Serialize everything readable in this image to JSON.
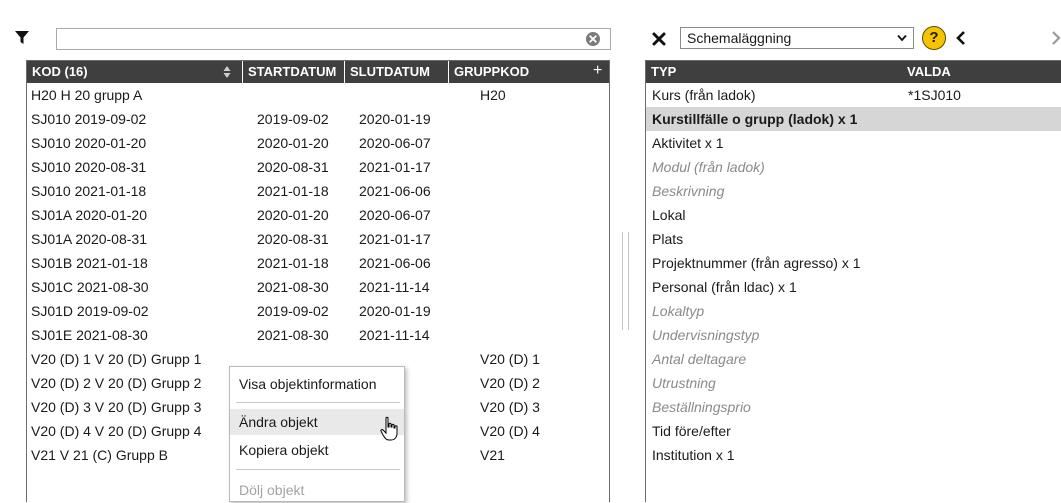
{
  "left_panel": {
    "filter_value": "",
    "columns": [
      "KOD (16)",
      "STARTDATUM",
      "SLUTDATUM",
      "GRUPPKOD"
    ],
    "rows": [
      {
        "kod": "H20 H 20 grupp A",
        "start": "",
        "slut": "",
        "grupp": "H20"
      },
      {
        "kod": "SJ010 2019-09-02",
        "start": "2019-09-02",
        "slut": "2020-01-19",
        "grupp": ""
      },
      {
        "kod": "SJ010 2020-01-20",
        "start": "2020-01-20",
        "slut": "2020-06-07",
        "grupp": ""
      },
      {
        "kod": "SJ010 2020-08-31",
        "start": "2020-08-31",
        "slut": "2021-01-17",
        "grupp": ""
      },
      {
        "kod": "SJ010 2021-01-18",
        "start": "2021-01-18",
        "slut": "2021-06-06",
        "grupp": ""
      },
      {
        "kod": "SJ01A 2020-01-20",
        "start": "2020-01-20",
        "slut": "2020-06-07",
        "grupp": ""
      },
      {
        "kod": "SJ01A 2020-08-31",
        "start": "2020-08-31",
        "slut": "2021-01-17",
        "grupp": ""
      },
      {
        "kod": "SJ01B 2021-01-18",
        "start": "2021-01-18",
        "slut": "2021-06-06",
        "grupp": ""
      },
      {
        "kod": "SJ01C 2021-08-30",
        "start": "2021-08-30",
        "slut": "2021-11-14",
        "grupp": ""
      },
      {
        "kod": "SJ01D 2019-09-02",
        "start": "2019-09-02",
        "slut": "2020-01-19",
        "grupp": ""
      },
      {
        "kod": "SJ01E 2021-08-30",
        "start": "2021-08-30",
        "slut": "2021-11-14",
        "grupp": ""
      },
      {
        "kod": "V20 (D) 1 V 20 (D) Grupp 1",
        "start": "",
        "slut": "",
        "grupp": "V20 (D) 1"
      },
      {
        "kod": "V20 (D) 2 V 20 (D) Grupp 2",
        "start": "",
        "slut": "",
        "grupp": "V20 (D) 2"
      },
      {
        "kod": "V20 (D) 3 V 20 (D) Grupp 3",
        "start": "",
        "slut": "",
        "grupp": "V20 (D) 3"
      },
      {
        "kod": "V20 (D) 4 V 20 (D) Grupp 4",
        "start": "",
        "slut": "",
        "grupp": "V20 (D) 4"
      },
      {
        "kod": "V21 V 21 (C) Grupp B",
        "start": "",
        "slut": "",
        "grupp": "V21"
      }
    ]
  },
  "context_menu": {
    "items": [
      "Visa objektinformation",
      "Ändra objekt",
      "Kopiera objekt",
      "Dölj objekt"
    ]
  },
  "right_panel": {
    "selected_view": "Schemaläggning",
    "help_label": "?",
    "columns": [
      "TYP",
      "VALDA"
    ],
    "rows": [
      {
        "typ": "Kurs (från ladok)",
        "valda": "*1SJ010",
        "style": "normal"
      },
      {
        "typ": "Kurstillfälle o grupp (ladok) x 1",
        "valda": "",
        "style": "bold"
      },
      {
        "typ": "Aktivitet x 1",
        "valda": "",
        "style": "normal"
      },
      {
        "typ": "Modul (från ladok)",
        "valda": "",
        "style": "italic"
      },
      {
        "typ": "Beskrivning",
        "valda": "",
        "style": "italic"
      },
      {
        "typ": "Lokal",
        "valda": "",
        "style": "normal"
      },
      {
        "typ": "Plats",
        "valda": "",
        "style": "normal"
      },
      {
        "typ": "Projektnummer (från agresso) x 1",
        "valda": "",
        "style": "normal"
      },
      {
        "typ": "Personal (från ldac) x 1",
        "valda": "",
        "style": "normal"
      },
      {
        "typ": "Lokaltyp",
        "valda": "",
        "style": "italic"
      },
      {
        "typ": "Undervisningstyp",
        "valda": "",
        "style": "italic"
      },
      {
        "typ": "Antal deltagare",
        "valda": "",
        "style": "italic"
      },
      {
        "typ": "Utrustning",
        "valda": "",
        "style": "italic"
      },
      {
        "typ": "Beställningsprio",
        "valda": "",
        "style": "italic"
      },
      {
        "typ": "Tid före/efter",
        "valda": "",
        "style": "normal"
      },
      {
        "typ": "Institution x 1",
        "valda": "",
        "style": "normal"
      }
    ]
  },
  "icons": {
    "filter": "filter-icon",
    "clear": "clear-circle-icon",
    "sort": "sort-icon",
    "add_column": "plus-icon",
    "close": "close-x-icon",
    "dropdown": "chevron-down-icon",
    "help": "help-icon",
    "prev": "chevron-left-icon",
    "next": "chevron-right-icon",
    "cursor": "hand-pointer-icon"
  },
  "colors": {
    "header_bg": "#3f3f3f",
    "selected_row_bg": "#d6d6d6",
    "help_bg": "#f5c400",
    "muted_text": "#8a8a8a"
  }
}
